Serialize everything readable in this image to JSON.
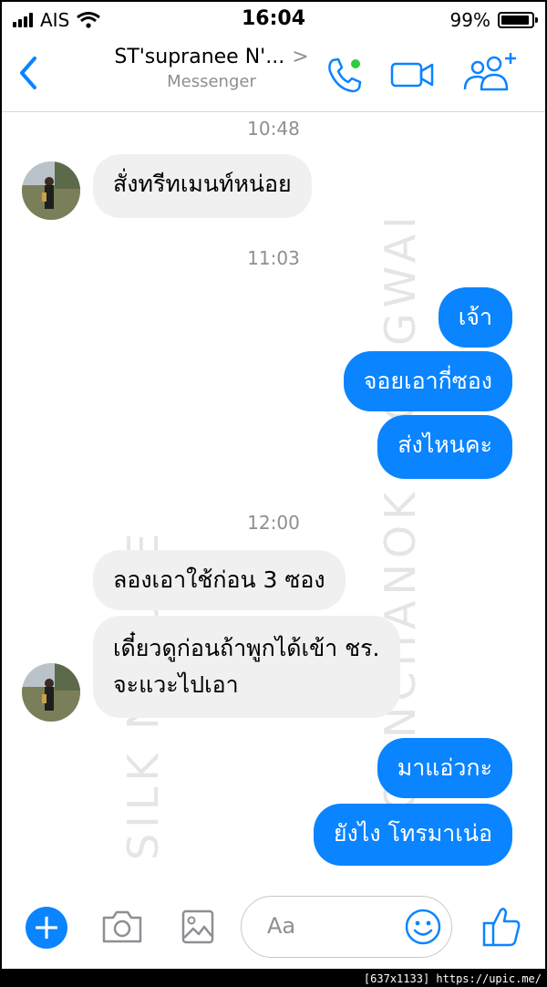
{
  "status_bar": {
    "carrier": "AIS",
    "time": "16:04",
    "battery": "99%"
  },
  "header": {
    "contact_name": "ST'supranee N'...",
    "chevron": ">",
    "subtitle": "Messenger"
  },
  "icons": {
    "back": "chevron-left-icon",
    "phone": "phone-icon",
    "video": "video-camera-icon",
    "group": "add-people-icon",
    "plus": "plus-icon",
    "camera": "camera-icon",
    "image": "image-icon",
    "emoji": "smiley-icon",
    "like": "thumbs-up-icon"
  },
  "colors": {
    "accent": "#0a84ff",
    "incoming_bubble": "#f1f0f0",
    "timestamp": "#8e8e93"
  },
  "chat": {
    "timestamps": [
      "10:48",
      "11:03",
      "12:00"
    ],
    "messages": [
      {
        "dir": "in",
        "text": "สั่งทรีทเมนท์หน่อย"
      },
      {
        "dir": "out",
        "text": "เจ้า"
      },
      {
        "dir": "out",
        "text": "จอยเอากี่ซอง"
      },
      {
        "dir": "out",
        "text": "ส่งไหนคะ"
      },
      {
        "dir": "in",
        "text": "ลองเอาใช้ก่อน 3 ซอง"
      },
      {
        "dir": "in",
        "lines": [
          "เดี๋ยวดูก่อนถ้าพูกได้เข้า ชร.",
          "จะแวะไปเอา"
        ]
      },
      {
        "dir": "out",
        "text": "มาแอ่วกะ"
      },
      {
        "dir": "out",
        "text": "ยังไง โทรมาเน่อ"
      }
    ]
  },
  "watermarks": [
    "SILK NATURE",
    "PORNCHANOK WONGWAI"
  ],
  "composer": {
    "placeholder": "Aa",
    "plus": "+"
  },
  "footer": "[637x1133] https://upic.me/"
}
